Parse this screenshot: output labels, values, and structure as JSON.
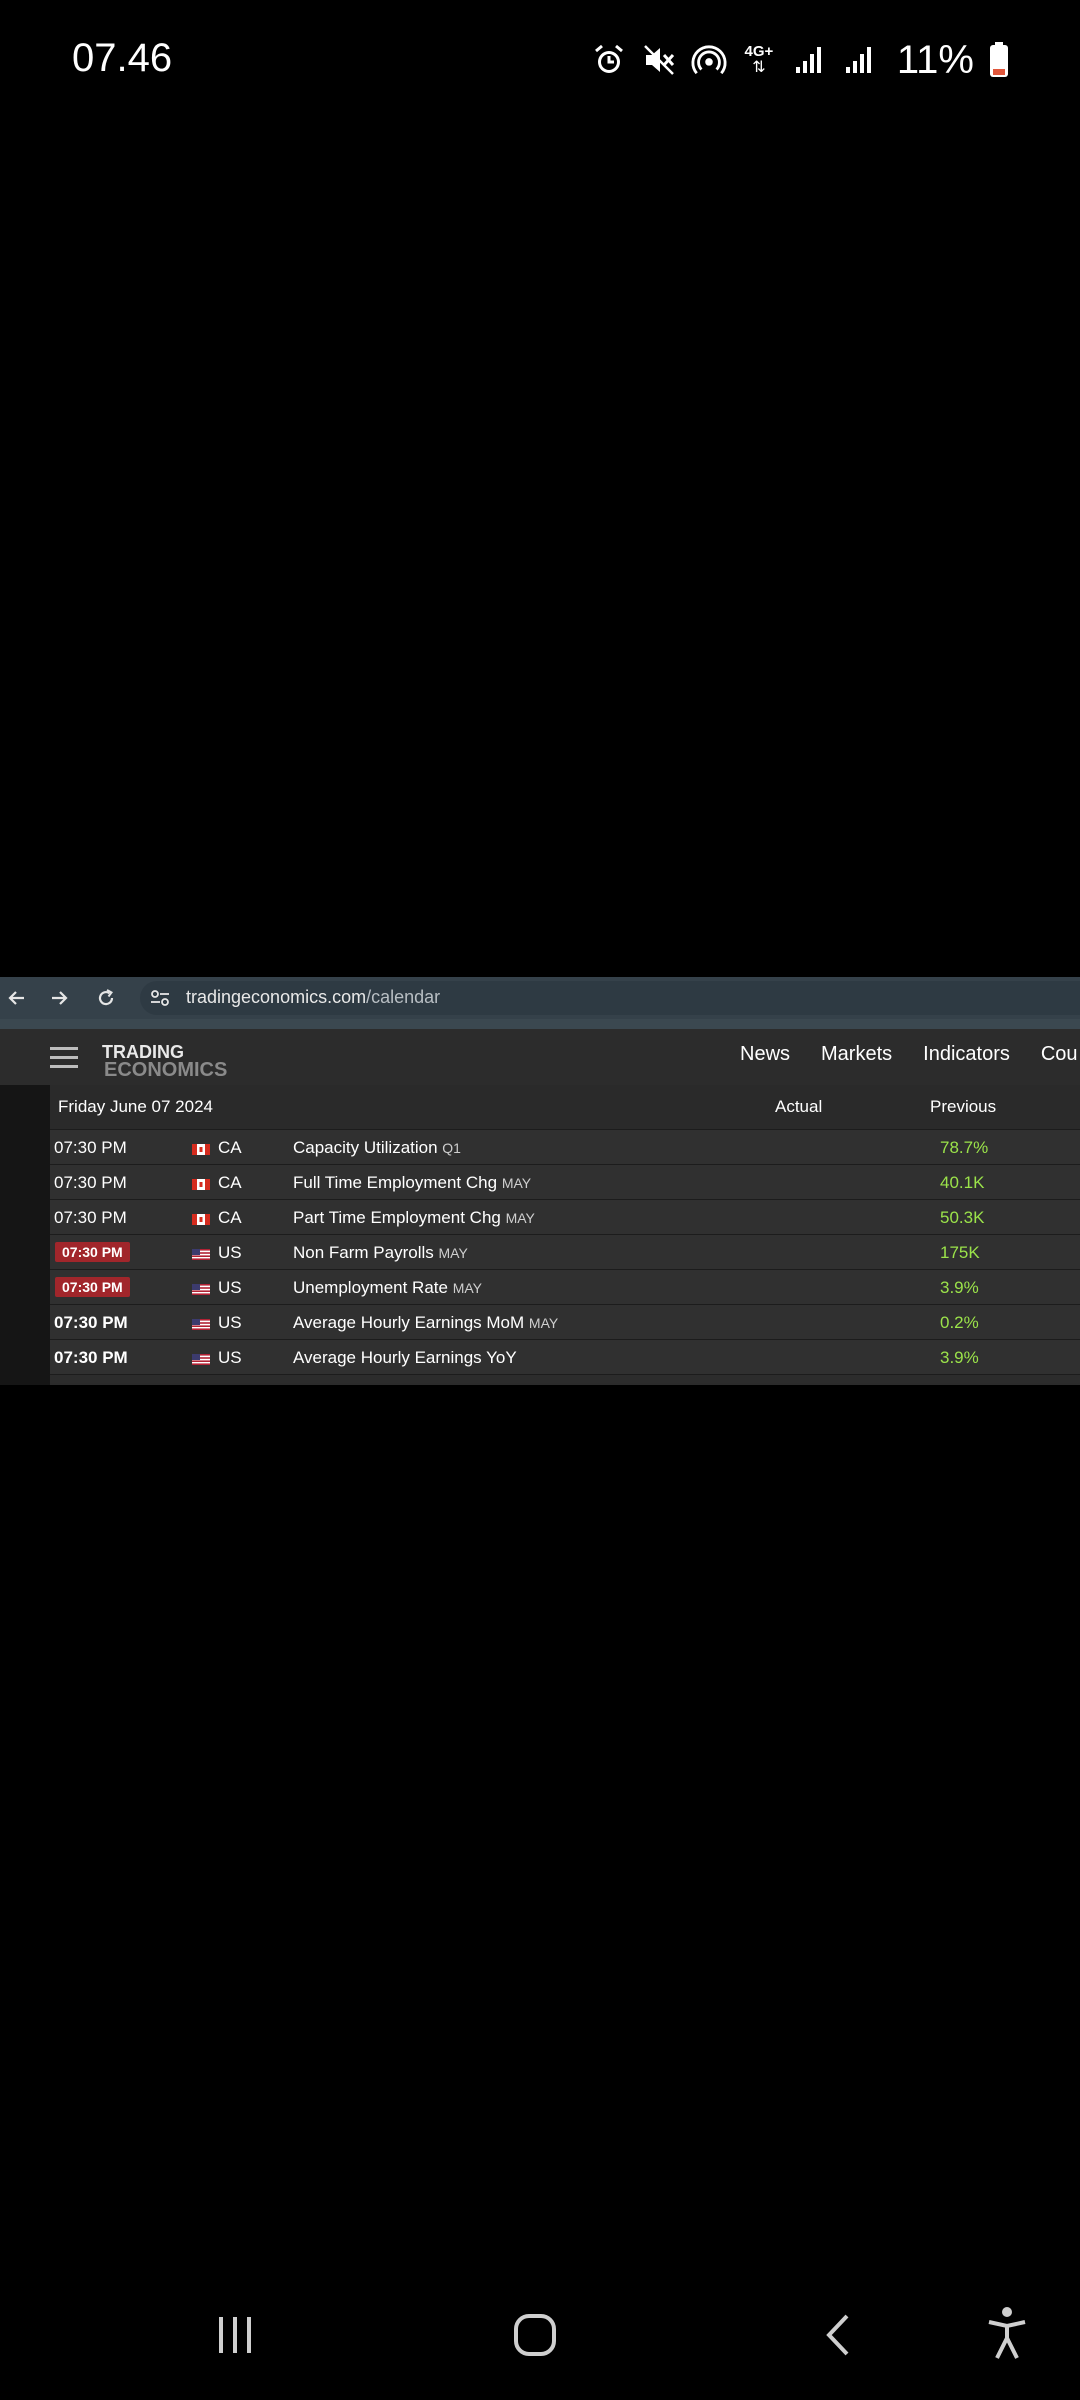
{
  "status_bar": {
    "time": "07.46",
    "network": "4G+",
    "battery": "11%",
    "icons": [
      "alarm-icon",
      "mute-icon",
      "hotspot-icon",
      "network-4g-icon",
      "signal-icon-1",
      "signal-icon-2",
      "battery-icon"
    ]
  },
  "browser": {
    "url_host": "tradingeconomics.com",
    "url_path": "/calendar"
  },
  "site": {
    "logo_line1": "TRADING",
    "logo_line2": "ECONOMICS",
    "nav": [
      "News",
      "Markets",
      "Indicators",
      "Cou"
    ]
  },
  "calendar": {
    "date": "Friday June 07 2024",
    "col_actual": "Actual",
    "col_previous": "Previous",
    "rows": [
      {
        "time": "07:30 PM",
        "country": "CA",
        "event": "Capacity Utilization",
        "ref": "Q1",
        "previous": "78.7%"
      },
      {
        "time": "07:30 PM",
        "country": "CA",
        "event": "Full Time Employment Chg",
        "ref": "MAY",
        "previous": "40.1K"
      },
      {
        "time": "07:30 PM",
        "country": "CA",
        "event": "Part Time Employment Chg",
        "ref": "MAY",
        "previous": "50.3K"
      },
      {
        "time": "07:30 PM",
        "country": "US",
        "event": "Non Farm Payrolls",
        "ref": "MAY",
        "previous": "175K"
      },
      {
        "time": "07:30 PM",
        "country": "US",
        "event": "Unemployment Rate",
        "ref": "MAY",
        "previous": "3.9%"
      },
      {
        "time": "07:30 PM",
        "country": "US",
        "event": "Average Hourly Earnings MoM",
        "ref": "MAY",
        "previous": "0.2%"
      },
      {
        "time": "07:30 PM",
        "country": "US",
        "event": "Average Hourly Earnings YoY",
        "ref": "",
        "previous": "3.9%"
      }
    ]
  },
  "colors": {
    "previous_value": "#9be34a",
    "highlight_badge": "#a1262b"
  }
}
